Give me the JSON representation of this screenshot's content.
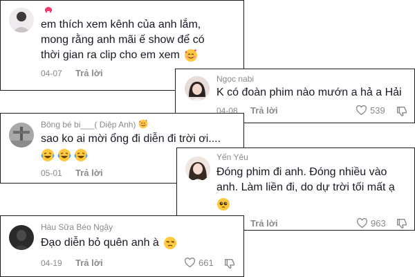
{
  "comments": [
    {
      "username": "",
      "lines": [
        "em thích xem kênh của anh lắm,",
        "mong rằng anh mãi ế show để có",
        "thời gian ra clip cho em xem"
      ],
      "emoji": "smiling-face-with-hearts",
      "date": "04-07",
      "reply": "Trả lời",
      "likes": ""
    },
    {
      "username": "Ngọc nabi",
      "lines": [
        "K có đoàn phim nào mướn a hả a Hải"
      ],
      "date": "04-08",
      "reply": "Trả lời",
      "likes": "539"
    },
    {
      "username": "Bông bé bi___( Diệp Anh)",
      "username_emoji": "smiling-face-with-hearts",
      "lines": [
        "sao ko ai mời ổng đi diễn đi trời ơi...."
      ],
      "emoji": "laughing-tears x3",
      "date": "05-01",
      "reply": "Trả lời",
      "likes": ""
    },
    {
      "username": "Yến Yêu",
      "lines": [
        "Đóng phim đi anh. Đóng nhiều vào",
        "anh. Làm liền đi, do dự trời tối mất ạ"
      ],
      "emoji": "pleading-face",
      "date": "",
      "reply": "Trả lời",
      "likes": "963"
    },
    {
      "username": "Hàu Sữa Béo Ngậy",
      "lines": [
        "Đạo diễn bỏ quên anh à"
      ],
      "emoji": "unamused-face",
      "date": "04-19",
      "reply": "Trả lời",
      "likes": "661"
    }
  ],
  "colors": {
    "text": "#161823",
    "muted": "#8a8a8a",
    "border": "#1a1a1a",
    "emoji": "#FFC83D",
    "heart": "#F3386A"
  }
}
